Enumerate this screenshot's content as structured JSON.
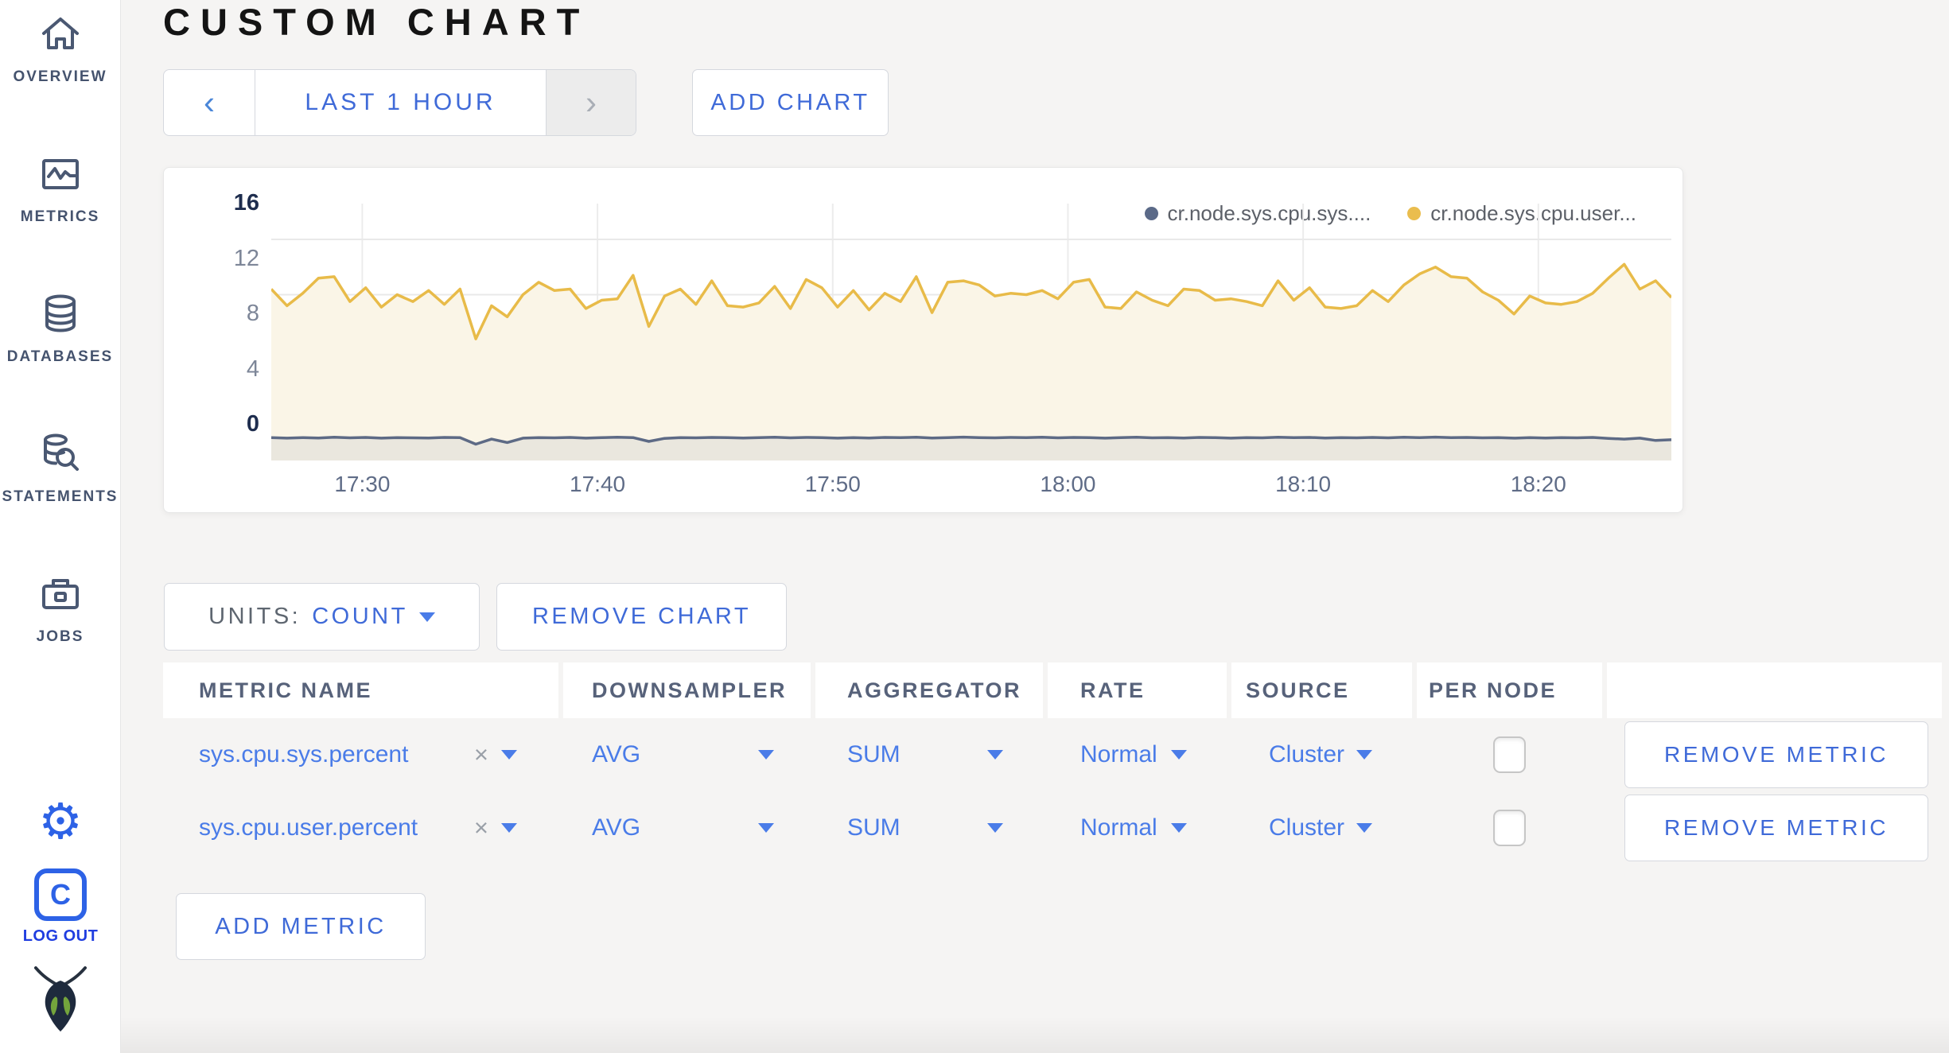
{
  "header": {
    "title": "CUSTOM CHART"
  },
  "sidebar": {
    "items": [
      {
        "label": "OVERVIEW"
      },
      {
        "label": "METRICS"
      },
      {
        "label": "DATABASES"
      },
      {
        "label": "STATEMENTS"
      },
      {
        "label": "JOBS"
      }
    ],
    "gear_glyph": "⚙",
    "logout_monogram": "C",
    "logout_label": "LOG OUT"
  },
  "toolbar": {
    "prev_glyph": "‹",
    "time_range_label": "LAST 1 HOUR",
    "next_glyph": "›",
    "add_chart_label": "ADD CHART"
  },
  "chart_controls": {
    "units_label": "UNITS:",
    "units_value": "COUNT",
    "remove_chart_label": "REMOVE CHART"
  },
  "legend": [
    {
      "label": "cr.node.sys.cpu.sys....",
      "color": "#5b6a88"
    },
    {
      "label": "cr.node.sys.cpu.user...",
      "color": "#eabd4e"
    }
  ],
  "chart_data": {
    "type": "line",
    "title": "",
    "xlabel": "",
    "ylabel": "",
    "ylim": [
      0,
      16
    ],
    "y_ticks": [
      0,
      4,
      8,
      12,
      16
    ],
    "x_ticks": [
      "17:30",
      "17:40",
      "17:50",
      "18:00",
      "18:10",
      "18:20"
    ],
    "x_tick_fractions": [
      0.065,
      0.233,
      0.401,
      0.569,
      0.737,
      0.905
    ],
    "grid": true,
    "legend_position": "top-right",
    "series": [
      {
        "name": "cr.node.sys.cpu.user...",
        "color": "#e8bb49",
        "fill": "#faf5e7",
        "values": [
          12.4,
          11.2,
          12.1,
          13.2,
          13.3,
          11.5,
          12.5,
          11.1,
          12.0,
          11.5,
          12.3,
          11.3,
          12.4,
          8.8,
          11.2,
          10.4,
          12.0,
          12.9,
          12.3,
          12.4,
          11.0,
          11.6,
          11.7,
          13.4,
          9.7,
          11.9,
          12.4,
          11.3,
          13.0,
          11.2,
          11.1,
          11.4,
          12.6,
          11.0,
          13.1,
          12.5,
          11.1,
          12.3,
          10.9,
          12.1,
          11.5,
          13.3,
          10.7,
          12.9,
          13.0,
          12.7,
          11.9,
          12.1,
          12.0,
          12.3,
          11.7,
          12.9,
          13.1,
          11.1,
          11.0,
          12.2,
          11.6,
          11.2,
          12.4,
          12.3,
          11.6,
          11.7,
          11.5,
          11.2,
          13.0,
          11.6,
          12.5,
          11.1,
          11.0,
          11.2,
          12.3,
          11.5,
          12.7,
          13.5,
          14.0,
          13.3,
          13.2,
          12.2,
          11.6,
          10.6,
          11.9,
          11.4,
          11.3,
          11.5,
          12.1,
          13.2,
          14.2,
          12.4,
          13.0,
          11.8
        ]
      },
      {
        "name": "cr.node.sys.cpu.sys....",
        "color": "#5d6a85",
        "fill": "#eae7de",
        "values": [
          1.65,
          1.62,
          1.66,
          1.63,
          1.68,
          1.64,
          1.67,
          1.62,
          1.66,
          1.64,
          1.63,
          1.67,
          1.65,
          1.18,
          1.55,
          1.3,
          1.62,
          1.66,
          1.64,
          1.67,
          1.62,
          1.65,
          1.68,
          1.66,
          1.38,
          1.6,
          1.66,
          1.64,
          1.67,
          1.65,
          1.63,
          1.66,
          1.68,
          1.64,
          1.67,
          1.65,
          1.62,
          1.66,
          1.63,
          1.67,
          1.65,
          1.68,
          1.63,
          1.66,
          1.69,
          1.66,
          1.64,
          1.67,
          1.65,
          1.68,
          1.64,
          1.67,
          1.65,
          1.62,
          1.66,
          1.68,
          1.64,
          1.66,
          1.63,
          1.67,
          1.65,
          1.62,
          1.66,
          1.64,
          1.68,
          1.65,
          1.67,
          1.63,
          1.66,
          1.64,
          1.67,
          1.64,
          1.68,
          1.66,
          1.69,
          1.65,
          1.67,
          1.64,
          1.66,
          1.62,
          1.65,
          1.63,
          1.66,
          1.64,
          1.67,
          1.6,
          1.55,
          1.62,
          1.45,
          1.5
        ]
      }
    ]
  },
  "metrics_table": {
    "close_glyph": "×",
    "columns": [
      "METRIC NAME",
      "DOWNSAMPLER",
      "AGGREGATOR",
      "RATE",
      "SOURCE",
      "PER NODE",
      ""
    ],
    "rows": [
      {
        "metric_name": "sys.cpu.sys.percent",
        "downsampler": "AVG",
        "aggregator": "SUM",
        "rate": "Normal",
        "source": "Cluster",
        "per_node": false,
        "remove_label": "REMOVE METRIC"
      },
      {
        "metric_name": "sys.cpu.user.percent",
        "downsampler": "AVG",
        "aggregator": "SUM",
        "rate": "Normal",
        "source": "Cluster",
        "per_node": false,
        "remove_label": "REMOVE METRIC"
      }
    ],
    "add_metric_label": "ADD METRIC"
  }
}
